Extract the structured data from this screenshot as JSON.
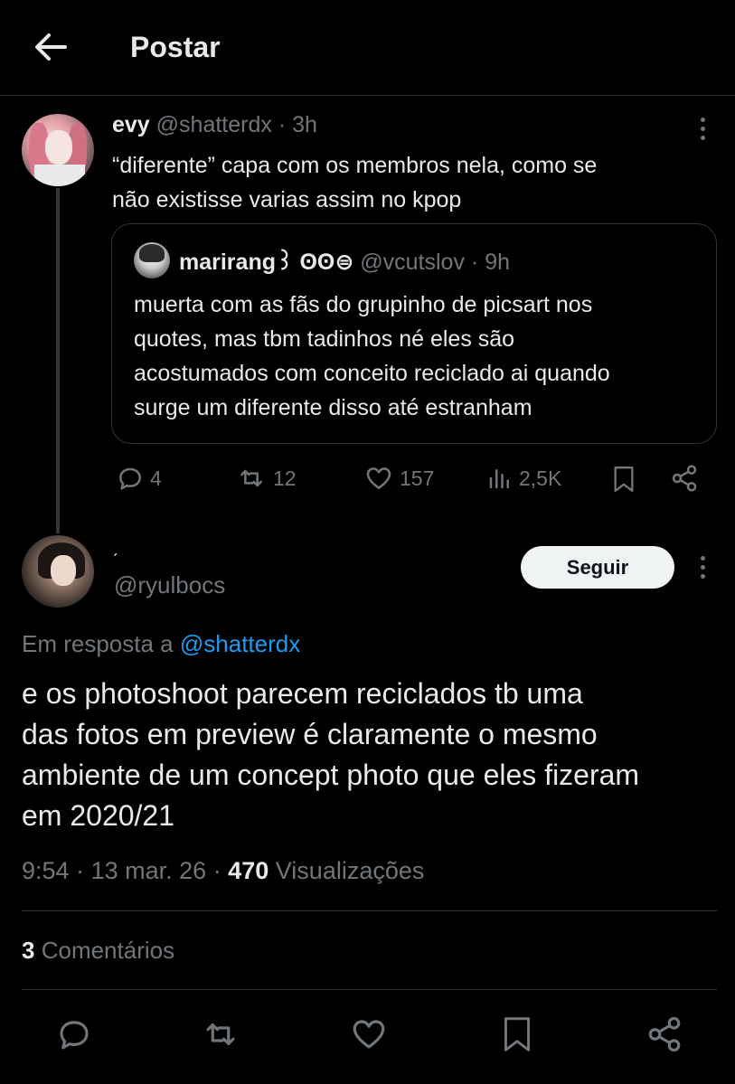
{
  "header": {
    "title": "Postar",
    "back_icon": "arrow-left-icon"
  },
  "parent_tweet": {
    "author_name": "evy",
    "handle": "@shatterdx",
    "separator": "·",
    "time": "3h",
    "text_line1": "“diferente” capa com os membros nela, como se",
    "text_line2": "não existisse varias assim no kpop",
    "quote": {
      "author_name": "marirang꒱ ʘʘ⊜",
      "handle": "@vcutslov",
      "separator": "·",
      "time": "9h",
      "text_line1": "muerta com as fãs do grupinho de picsart nos",
      "text_line2": "quotes, mas tbm tadinhos né eles são",
      "text_line3": "acostumados com conceito reciclado ai quando",
      "text_line4": "surge um diferente disso até estranham"
    },
    "actions": {
      "replies": "4",
      "reposts": "12",
      "likes": "157",
      "views": "2,5K"
    }
  },
  "main_tweet": {
    "author_name": "ˏ",
    "handle": "@ryulbocs",
    "follow_label": "Seguir",
    "reply_prefix": "Em resposta a",
    "reply_to": "@shatterdx",
    "text_line1": "e os photoshoot parecem reciclados tb uma",
    "text_line2": "das fotos em preview é claramente o mesmo",
    "text_line3": "ambiente de um concept photo que eles fizeram",
    "text_line4": "em 2020/21",
    "time": "9:54",
    "sep1": "·",
    "date": "13 mar. 26",
    "sep2": "·",
    "views_count": "470",
    "views_label": "Visualizações",
    "comments_count": "3",
    "comments_label": "Comentários"
  },
  "colors": {
    "background": "#000000",
    "text": "#e7e9ea",
    "muted": "#71767b",
    "link": "#1d9bf0",
    "border": "#2f3336"
  }
}
